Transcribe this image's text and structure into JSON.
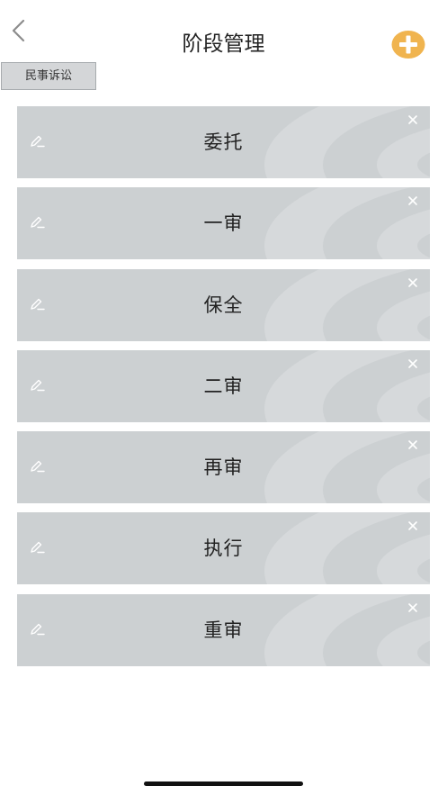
{
  "nav": {
    "back_icon": "chevron-left-icon",
    "title": "阶段管理",
    "add_icon": "plus-circle-icon",
    "add_color": "#f0b44f"
  },
  "case_type": {
    "label": "民事诉讼"
  },
  "stages": [
    {
      "name": "委托",
      "edit_icon": "pencil-icon",
      "delete_icon": "close-icon"
    },
    {
      "name": "一审",
      "edit_icon": "pencil-icon",
      "delete_icon": "close-icon"
    },
    {
      "name": "保全",
      "edit_icon": "pencil-icon",
      "delete_icon": "close-icon"
    },
    {
      "name": "二审",
      "edit_icon": "pencil-icon",
      "delete_icon": "close-icon"
    },
    {
      "name": "再审",
      "edit_icon": "pencil-icon",
      "delete_icon": "close-icon"
    },
    {
      "name": "执行",
      "edit_icon": "pencil-icon",
      "delete_icon": "close-icon"
    },
    {
      "name": "重审",
      "edit_icon": "pencil-icon",
      "delete_icon": "close-icon"
    }
  ],
  "colors": {
    "card_background": "#ccd0d2",
    "card_pattern": "#d6d9db",
    "tag_background": "#d4d6d8"
  }
}
